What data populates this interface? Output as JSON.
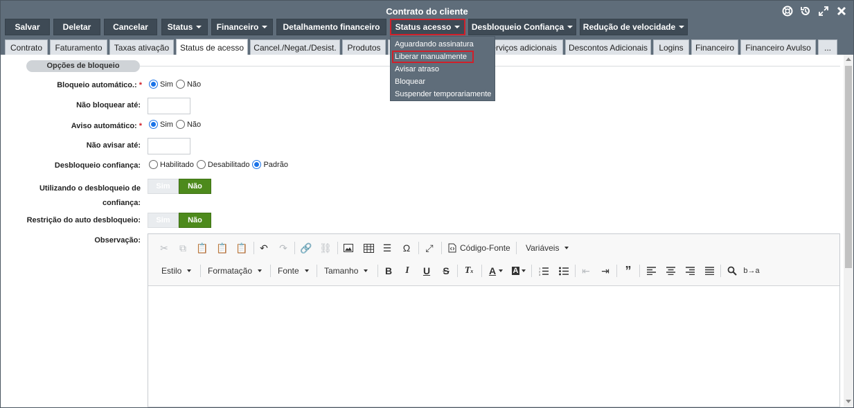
{
  "window": {
    "title": "Contrato do cliente"
  },
  "window_icons": [
    "lifebuoy-icon",
    "history-icon",
    "expand-icon",
    "close-icon"
  ],
  "toolbar": {
    "buttons": [
      {
        "label": "Salvar",
        "dropdown": false
      },
      {
        "label": "Deletar",
        "dropdown": false
      },
      {
        "label": "Cancelar",
        "dropdown": false
      },
      {
        "label": "Status",
        "dropdown": true
      },
      {
        "label": "Financeiro",
        "dropdown": true
      },
      {
        "label": "Detalhamento financeiro",
        "dropdown": false
      },
      {
        "label": "Status acesso",
        "dropdown": true,
        "highlighted": true
      },
      {
        "label": "Desbloqueio Confiança",
        "dropdown": true
      },
      {
        "label": "Redução de velocidade",
        "dropdown": true
      }
    ]
  },
  "tabs": [
    "Contrato",
    "Faturamento",
    "Taxas ativação",
    "Status de acesso",
    "Cancel./Negat./Desist.",
    "Produtos",
    "Serviços adicionais",
    "Descontos Adicionais",
    "Logins",
    "Financeiro",
    "Financeiro Avulso",
    "..."
  ],
  "active_tab": "Status de acesso",
  "status_acesso_menu": {
    "items": [
      "Aguardando assinatura",
      "Liberar manualmente",
      "Avisar atraso",
      "Bloquear",
      "Suspender temporariamente"
    ],
    "highlighted": "Liberar manualmente"
  },
  "form": {
    "section_title": "Opções de bloqueio",
    "bloqueio_automatico": {
      "label": "Bloqueio automático.:",
      "required": "*",
      "options": [
        "Sim",
        "Não"
      ],
      "selected": "Sim"
    },
    "nao_bloquear_ate": {
      "label": "Não bloquear até:",
      "value": ""
    },
    "aviso_automatico": {
      "label": "Aviso automático:",
      "required": "*",
      "options": [
        "Sim",
        "Não"
      ],
      "selected": "Sim"
    },
    "nao_avisar_ate": {
      "label": "Não avisar até:",
      "value": ""
    },
    "desbloqueio_confianca": {
      "label": "Desbloqueio confiança:",
      "options": [
        "Habilitado",
        "Desabilitado",
        "Padrão"
      ],
      "selected": "Padrão"
    },
    "utilizando_desbloqueio": {
      "label_line1": "Utilizando o desbloqueio de",
      "label_line2": "confiança:",
      "off": "Sim",
      "on": "Não",
      "selected": "Não"
    },
    "restricao_auto_desbloqueio": {
      "label": "Restrição do auto desbloqueio:",
      "off": "Sim",
      "on": "Não",
      "selected": "Não"
    },
    "observacao": {
      "label": "Observação:"
    }
  },
  "editor": {
    "row1_text": {
      "source": "Código-Fonte",
      "variables": "Variáveis"
    },
    "row2_dropdowns": [
      "Estilo",
      "Formatação",
      "Fonte",
      "Tamanho"
    ],
    "icons_row1": [
      "cut-icon",
      "copy-icon",
      "paste-icon",
      "paste-text-icon",
      "paste-word-icon",
      "undo-icon",
      "redo-icon",
      "link-icon",
      "unlink-icon",
      "image-icon",
      "table-icon",
      "horizontal-line-icon",
      "special-char-icon",
      "maximize-icon",
      "source-icon"
    ],
    "icons_row2": [
      "bold-icon",
      "italic-icon",
      "underline-icon",
      "strike-icon",
      "clear-format-icon",
      "text-color-icon",
      "bg-color-icon",
      "numbered-list-icon",
      "bullet-list-icon",
      "outdent-icon",
      "indent-icon",
      "blockquote-icon",
      "align-left-icon",
      "align-center-icon",
      "align-right-icon",
      "justify-icon",
      "find-icon",
      "replace-icon"
    ]
  }
}
